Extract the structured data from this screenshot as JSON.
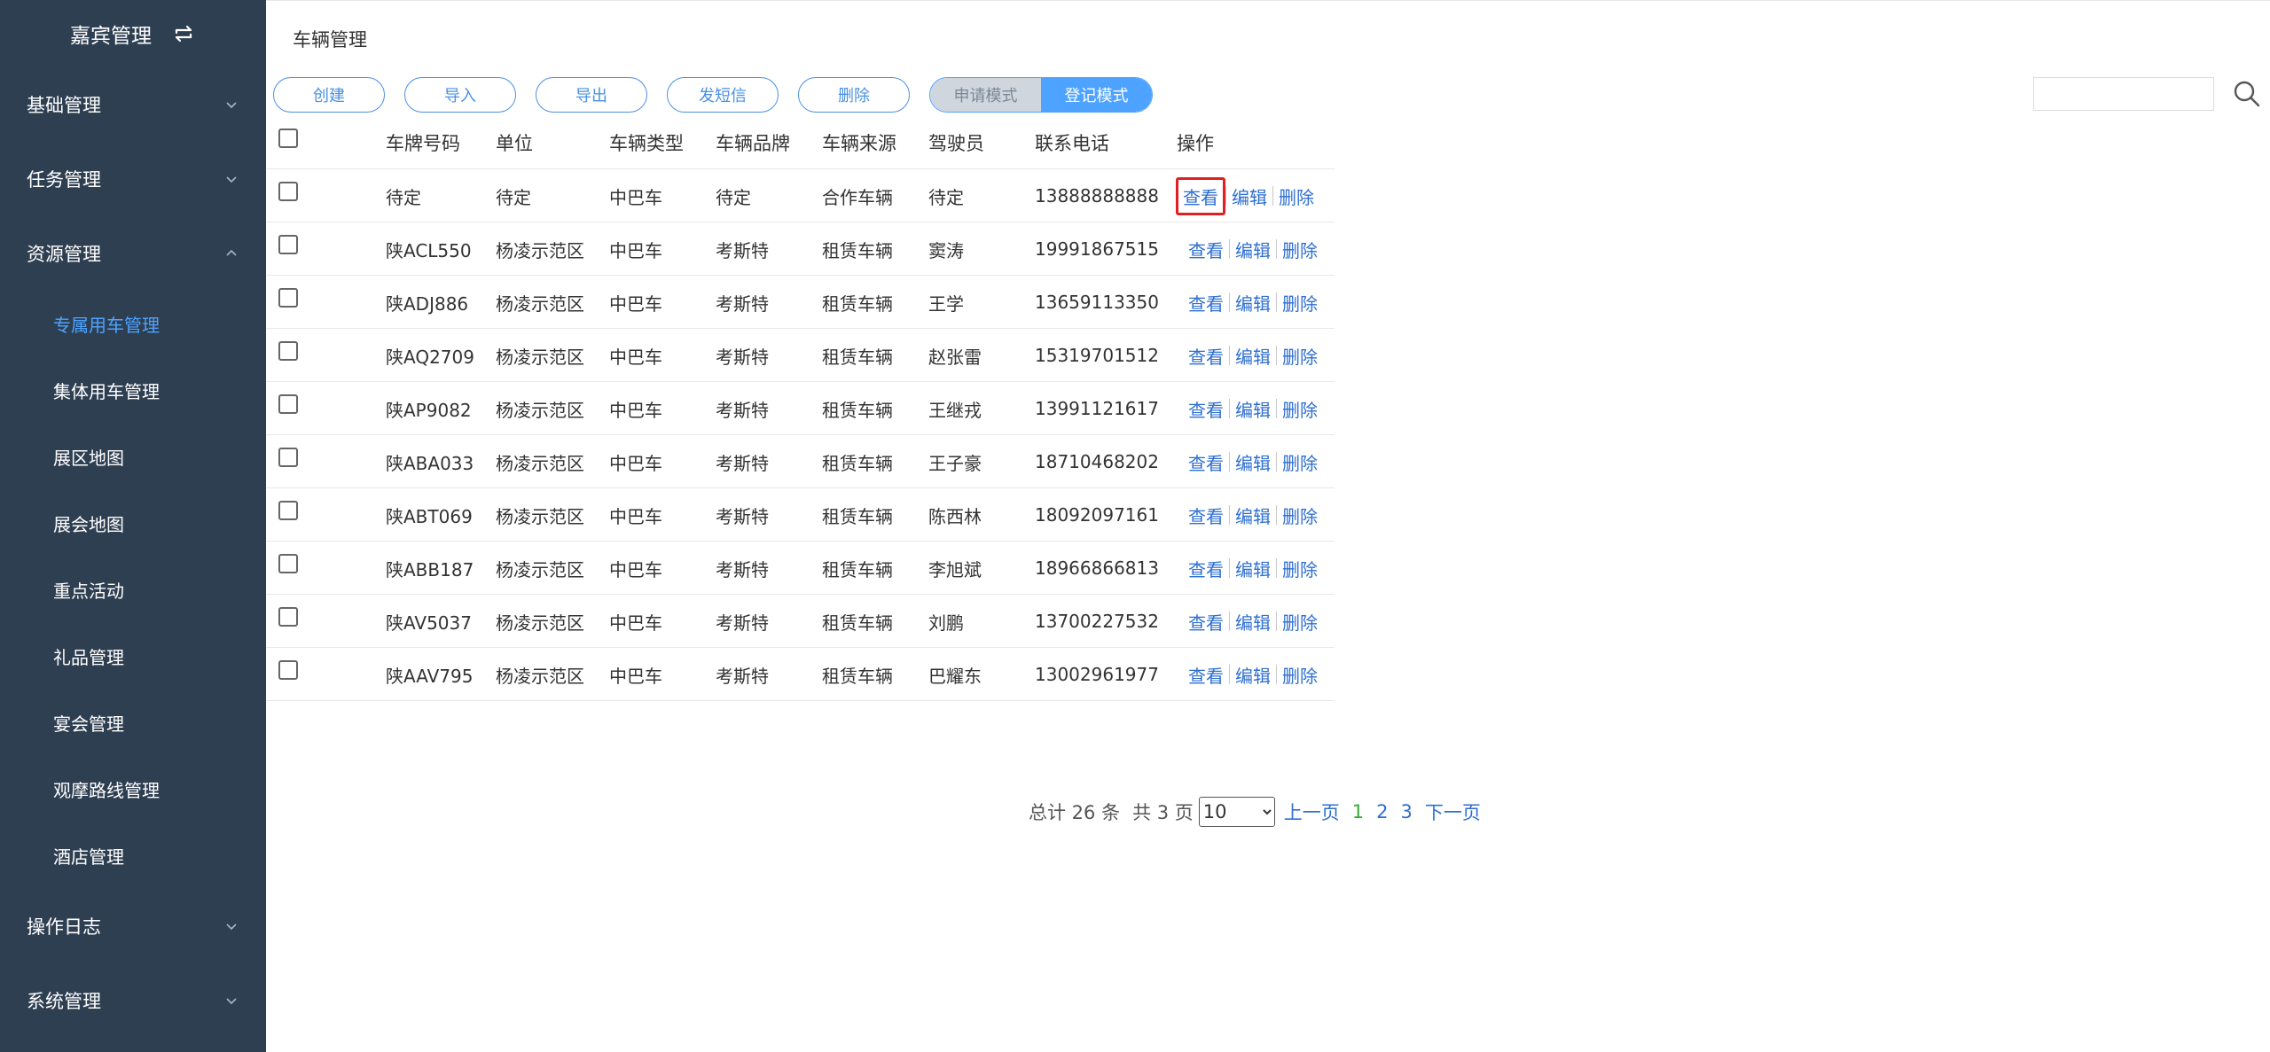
{
  "sidebar": {
    "brand": "嘉宾管理",
    "groups": [
      {
        "label": "基础管理"
      },
      {
        "label": "任务管理"
      },
      {
        "label": "资源管理"
      },
      {
        "label": "操作日志"
      },
      {
        "label": "系统管理"
      }
    ],
    "resource_items": [
      {
        "label": "专属用车管理"
      },
      {
        "label": "集体用车管理"
      },
      {
        "label": "展区地图"
      },
      {
        "label": "展会地图"
      },
      {
        "label": "重点活动"
      },
      {
        "label": "礼品管理"
      },
      {
        "label": "宴会管理"
      },
      {
        "label": "观摩路线管理"
      },
      {
        "label": "酒店管理"
      }
    ]
  },
  "page": {
    "title": "车辆管理"
  },
  "toolbar": {
    "create": "创建",
    "import": "导入",
    "export": "导出",
    "sms": "发短信",
    "delete": "删除",
    "mode_apply": "申请模式",
    "mode_register": "登记模式",
    "search_value": ""
  },
  "table": {
    "headers": [
      "车牌号码",
      "单位",
      "车辆类型",
      "车辆品牌",
      "车辆来源",
      "驾驶员",
      "联系电话",
      "操作"
    ],
    "op_view": "查看",
    "op_edit": "编辑",
    "op_delete": "删除",
    "rows": [
      [
        "待定",
        "待定",
        "中巴车",
        "待定",
        "合作车辆",
        "待定",
        "13888888888"
      ],
      [
        "陕ACL550",
        "杨凌示范区",
        "中巴车",
        "考斯特",
        "租赁车辆",
        "窦涛",
        "19991867515"
      ],
      [
        "陕ADJ886",
        "杨凌示范区",
        "中巴车",
        "考斯特",
        "租赁车辆",
        "王学",
        "13659113350"
      ],
      [
        "陕AQ2709",
        "杨凌示范区",
        "中巴车",
        "考斯特",
        "租赁车辆",
        "赵张雷",
        "15319701512"
      ],
      [
        "陕AP9082",
        "杨凌示范区",
        "中巴车",
        "考斯特",
        "租赁车辆",
        "王继戎",
        "13991121617"
      ],
      [
        "陕ABA033",
        "杨凌示范区",
        "中巴车",
        "考斯特",
        "租赁车辆",
        "王子豪",
        "18710468202"
      ],
      [
        "陕ABT069",
        "杨凌示范区",
        "中巴车",
        "考斯特",
        "租赁车辆",
        "陈西林",
        "18092097161"
      ],
      [
        "陕ABB187",
        "杨凌示范区",
        "中巴车",
        "考斯特",
        "租赁车辆",
        "李旭斌",
        "18966866813"
      ],
      [
        "陕AV5037",
        "杨凌示范区",
        "中巴车",
        "考斯特",
        "租赁车辆",
        "刘鹏",
        "13700227532"
      ],
      [
        "陕AAV795",
        "杨凌示范区",
        "中巴车",
        "考斯特",
        "租赁车辆",
        "巴耀东",
        "13002961977"
      ]
    ]
  },
  "pagination": {
    "total": "总计 26 条",
    "pages": "共 3 页",
    "page_size": "10",
    "prev": "上一页",
    "page_numbers": [
      "1",
      "2",
      "3"
    ],
    "next": "下一页"
  }
}
